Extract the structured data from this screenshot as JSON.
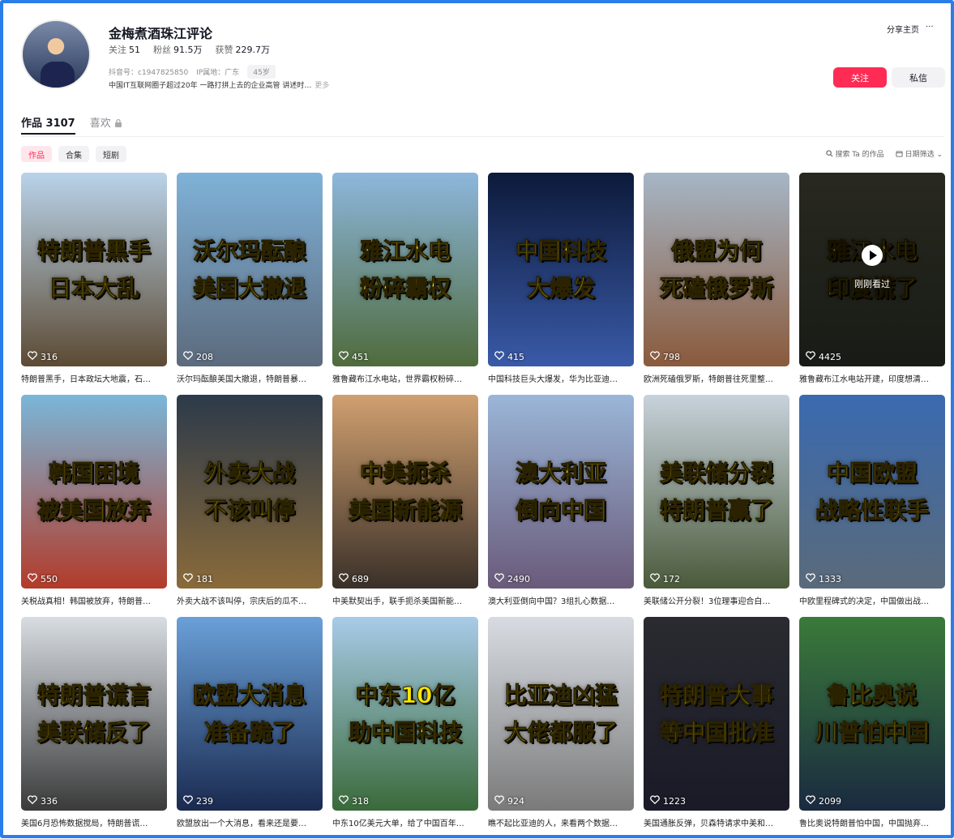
{
  "profile": {
    "name": "金梅煮酒珠江评论",
    "follow_label": "关注",
    "follow_count": "51",
    "fans_label": "粉丝",
    "fans_count": "91.5万",
    "likes_label": "获赞",
    "likes_count": "229.7万",
    "douyin_id": "抖音号：c1947825850",
    "ip": "IP属地：广东",
    "age": "45岁",
    "bio": "中国IT互联网圈子超过20年 一路打拼上去的企业高管 讲述时…",
    "bio_more": "更多"
  },
  "actions": {
    "share": "分享主页",
    "more": "···",
    "follow_btn": "关注",
    "message_btn": "私信"
  },
  "tabs": {
    "works": "作品 3107",
    "likes": "喜欢"
  },
  "chips": [
    "作品",
    "合集",
    "短剧"
  ],
  "tools": {
    "search": "搜索 Ta 的作品",
    "date_filter": "日期筛选"
  },
  "watched_label": "刚刚看过",
  "videos": [
    {
      "cap1": "特朗普黑手",
      "cap2": "日本大乱",
      "likes": "316",
      "desc": "特朗普黑手，日本政坛大地震，石…"
    },
    {
      "cap1": "沃尔玛酝酿",
      "cap2": "美国大撤退",
      "likes": "208",
      "desc": "沃尔玛酝酿美国大撤退，特朗普暴…"
    },
    {
      "cap1": "雅江水电",
      "cap2": "粉碎霸权",
      "likes": "451",
      "desc": "雅鲁藏布江水电站，世界霸权粉碎…"
    },
    {
      "cap1": "中国科技",
      "cap2": "大爆发",
      "likes": "415",
      "desc": "中国科技巨头大爆发，华为比亚迪…"
    },
    {
      "cap1": "俄盟为何",
      "cap2": "死磕俄罗斯",
      "likes": "798",
      "desc": "欧洲死磕俄罗斯，特朗普往死里整…"
    },
    {
      "cap1": "雅江水电",
      "cap2": "印度慌了",
      "likes": "4425",
      "desc": "雅鲁藏布江水电站开建，印度想清…"
    },
    {
      "cap1": "韩国困境",
      "cap2": "被美国放弃",
      "likes": "550",
      "desc": "关税战真相！韩国被放弃，特朗普…"
    },
    {
      "cap1": "外卖大战",
      "cap2": "不该叫停",
      "likes": "181",
      "desc": "外卖大战不该叫停，宗庆后的瓜不…"
    },
    {
      "cap1": "中美扼杀",
      "cap2": "美国新能源",
      "likes": "689",
      "desc": "中美默契出手，联手扼杀美国新能…"
    },
    {
      "cap1": "澳大利亚",
      "cap2": "倒向中国",
      "likes": "2490",
      "desc": "澳大利亚倒向中国？3组扎心数据…"
    },
    {
      "cap1": "美联储分裂",
      "cap2": "特朗普赢了",
      "likes": "172",
      "desc": "美联储公开分裂！3位理事迎合白…"
    },
    {
      "cap1": "中国欧盟",
      "cap2": "战略性联手",
      "likes": "1333",
      "desc": "中欧里程碑式的决定，中国做出战…"
    },
    {
      "cap1": "特朗普谎言",
      "cap2": "美联储反了",
      "likes": "336",
      "desc": "美国6月恐怖数据搅局，特朗普谎…"
    },
    {
      "cap1": "欧盟大消息",
      "cap2": "准备跪了",
      "likes": "239",
      "desc": "欧盟放出一个大消息，看来还是要…"
    },
    {
      "cap1": "中东10亿",
      "cap2": "助中国科技",
      "likes": "318",
      "desc": "中东10亿美元大单，给了中国百年…"
    },
    {
      "cap1": "比亚迪凶猛",
      "cap2": "大佬都服了",
      "likes": "924",
      "desc": "瞧不起比亚迪的人，来看两个数据…"
    },
    {
      "cap1": "特朗普大事",
      "cap2": "等中国批准",
      "likes": "1223",
      "desc": "美国通胀反弹，贝森特请求中美和…"
    },
    {
      "cap1": "鲁比奥说",
      "cap2": "川普怕中国",
      "likes": "2099",
      "desc": "鲁比奥说特朗普怕中国，中国抛弃…"
    }
  ],
  "thumb_colors": [
    [
      "#b9d3ea",
      "#5c4a33"
    ],
    [
      "#7fb2d8",
      "#5c6a7c"
    ],
    [
      "#8db7dd",
      "#4f6b3c"
    ],
    [
      "#0c1a3a",
      "#3a5aa8"
    ],
    [
      "#a6b6c6",
      "#8a5a3c"
    ],
    [
      "#4a4a3a",
      "#2c3328"
    ],
    [
      "#7ab7d9",
      "#b33b2a"
    ],
    [
      "#2c3a4a",
      "#8a6a3a"
    ],
    [
      "#d0a070",
      "#3a3028"
    ],
    [
      "#9ab6d8",
      "#6a5a7a"
    ],
    [
      "#c8d2dc",
      "#4a5a3a"
    ],
    [
      "#3a6ab0",
      "#5a6a7a"
    ],
    [
      "#d8dde2",
      "#3a3a3a"
    ],
    [
      "#6aa0d8",
      "#1a2a50"
    ],
    [
      "#a8cbe8",
      "#3a6a3a"
    ],
    [
      "#d8dce2",
      "#7a7a7a"
    ],
    [
      "#2a2a30",
      "#1a1a28"
    ],
    [
      "#3a7a3a",
      "#1a2a40"
    ]
  ]
}
